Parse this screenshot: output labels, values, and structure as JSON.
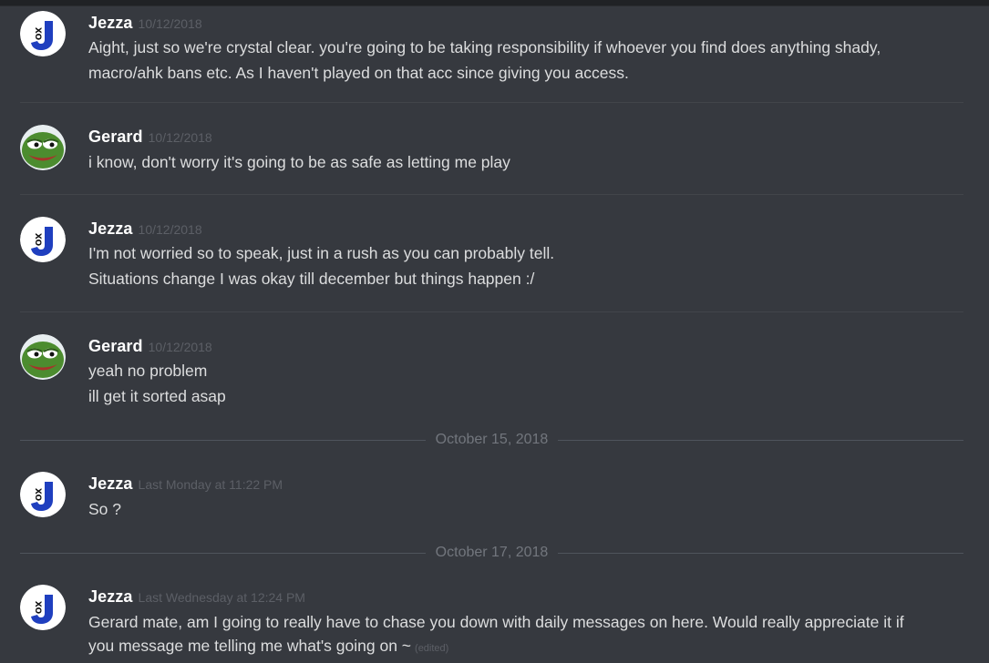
{
  "messages": [
    {
      "author": "Jezza",
      "avatar": "jezza-avatar",
      "time": "10/12/2018",
      "lines": [
        "Aight, just so we're crystal clear. you're going to be taking responsibility if whoever you find does anything shady,",
        "macro/ahk bans etc. As I haven't played on that acc since giving you access."
      ]
    },
    {
      "author": "Gerard",
      "avatar": "gerard-avatar",
      "time": "10/12/2018",
      "lines": [
        "i know, don't worry it's going to be as safe as letting me play"
      ]
    },
    {
      "author": "Jezza",
      "avatar": "jezza-avatar",
      "time": "10/12/2018",
      "lines": [
        "I'm not worried so to speak, just in a rush as you can probably tell.",
        "Situations change I was okay till december but things happen :/"
      ]
    },
    {
      "author": "Gerard",
      "avatar": "gerard-avatar",
      "time": "10/12/2018",
      "lines": [
        "yeah no problem",
        "ill get it sorted asap"
      ]
    },
    {
      "author": "Jezza",
      "avatar": "jezza-avatar",
      "time": "Last Monday at 11:22 PM",
      "lines": [
        "So ?"
      ]
    },
    {
      "author": "Jezza",
      "avatar": "jezza-avatar",
      "time": "Last Wednesday at 12:24 PM",
      "lines": [
        "Gerard mate, am I going to really have to chase you down with daily messages on here. Would really appreciate it if",
        "you message me telling me what's going on ~"
      ],
      "edited": "(edited)"
    }
  ],
  "date_dividers": [
    "October 15, 2018",
    "October 17, 2018"
  ],
  "colors": {
    "background": "#36393f",
    "username": "#ffffff",
    "message_text": "#dcddde",
    "timestamp": "#5c5f66",
    "jezza_avatar_blue": "#1f3fbf",
    "gerard_avatar_green": "#4c8c2f"
  }
}
